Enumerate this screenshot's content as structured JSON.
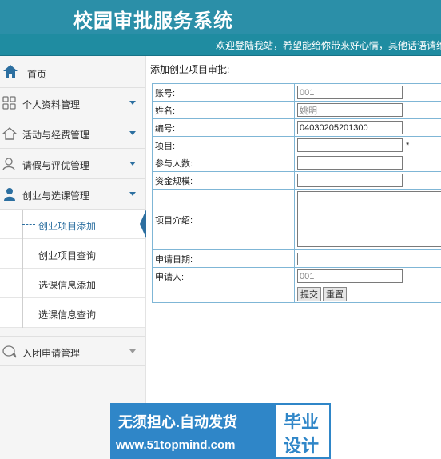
{
  "app": {
    "title": "校园审批服务系统",
    "marquee": "欢迎登陆我站，希望能给你带来好心情，其他话语请维"
  },
  "sidebar": {
    "home": {
      "label": "首页",
      "icon": "home-icon"
    },
    "groups": [
      {
        "label": "个人资料管理",
        "icon": "grid-icon"
      },
      {
        "label": "活动与经费管理",
        "icon": "house-outline-icon"
      },
      {
        "label": "请假与评优管理",
        "icon": "users-icon"
      },
      {
        "label": "创业与选课管理",
        "icon": "user-icon",
        "expanded": true
      }
    ],
    "sub_items": [
      {
        "label": "创业项目添加",
        "active": true
      },
      {
        "label": "创业项目查询"
      },
      {
        "label": "选课信息添加"
      },
      {
        "label": "选课信息查询"
      }
    ],
    "last": {
      "label": "入团申请管理",
      "icon": "chat-icon"
    }
  },
  "form": {
    "heading": "添加创业项目审批:",
    "fields": {
      "account": {
        "label": "账号:",
        "value": "001"
      },
      "name": {
        "label": "姓名:",
        "value": "姚明"
      },
      "code": {
        "label": "编号:",
        "value": "04030205201300"
      },
      "project": {
        "label": "项目:",
        "value": "",
        "required_mark": "*"
      },
      "members": {
        "label": "参与人数:",
        "value": ""
      },
      "funds": {
        "label": "资金规模:",
        "value": ""
      },
      "intro": {
        "label": "项目介绍:",
        "value": ""
      },
      "date": {
        "label": "申请日期:",
        "value": ""
      },
      "applicant": {
        "label": "申请人:",
        "value": "001"
      }
    },
    "submit_label": "提交",
    "reset_label": "重置"
  },
  "watermark": {
    "line1": "无须担心.自动发货",
    "line2": "www.51topmind.com",
    "badge1": "毕业",
    "badge2": "设计"
  },
  "colors": {
    "header": "#2b8fa8",
    "accent": "#2c6fa0",
    "table_border": "#7fb6d6",
    "watermark": "#2f86c8"
  }
}
